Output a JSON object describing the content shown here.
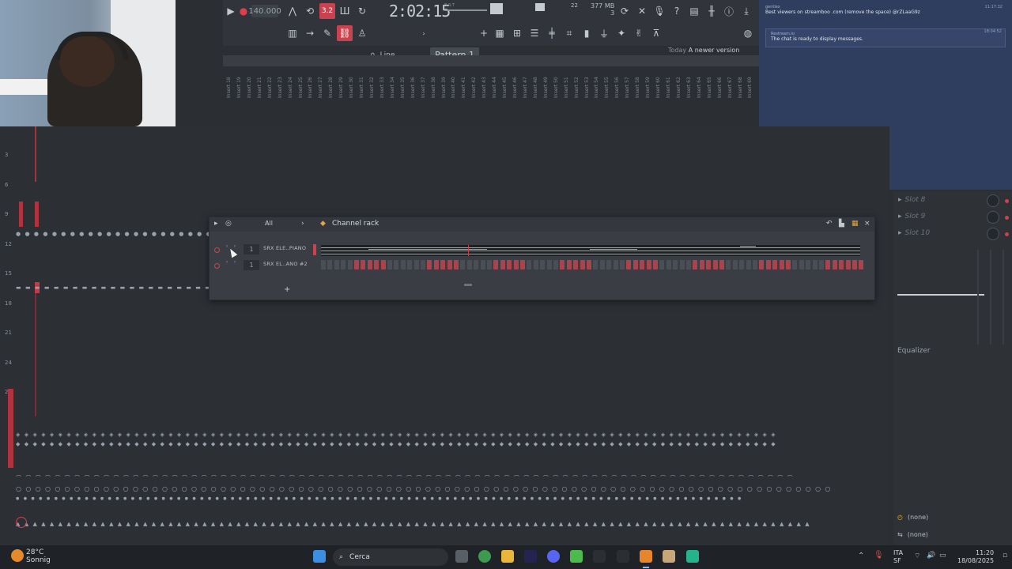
{
  "toolbar": {
    "tempo": "140.000",
    "time": "2:02:15",
    "time_sub": "B:S:T",
    "mem_top": "22",
    "mem": "377 MB",
    "mem_sub": "3",
    "line_label": "Line",
    "pattern_label": "Pattern 1",
    "news_today": "Today",
    "news_text": "A newer version of FL Studio is available!"
  },
  "chat": {
    "messages": [
      {
        "user": "gentlex",
        "text": "Best viewers on streamboo .com (remove the space) @rZLaaG9z",
        "time": "11:17:32"
      },
      {
        "user": "Restream.io",
        "text": "The chat is ready to display messages.",
        "time": "18:04:52"
      }
    ]
  },
  "mixer": {
    "insert_labels": [
      "Insert 18",
      "Insert 19",
      "Insert 20",
      "Insert 21",
      "Insert 22",
      "Insert 23",
      "Insert 24",
      "Insert 25",
      "Insert 26",
      "Insert 27",
      "Insert 28",
      "Insert 29",
      "Insert 30",
      "Insert 31",
      "Insert 32",
      "Insert 33",
      "Insert 34",
      "Insert 35",
      "Insert 36",
      "Insert 37",
      "Insert 38",
      "Insert 39",
      "Insert 40",
      "Insert 41",
      "Insert 42",
      "Insert 43",
      "Insert 44",
      "Insert 45",
      "Insert 46",
      "Insert 47",
      "Insert 48",
      "Insert 49",
      "Insert 50",
      "Insert 51",
      "Insert 52",
      "Insert 53",
      "Insert 54",
      "Insert 55",
      "Insert 56",
      "Insert 57",
      "Insert 58",
      "Insert 59",
      "Insert 60",
      "Insert 61",
      "Insert 62",
      "Insert 63",
      "Insert 64",
      "Insert 65",
      "Insert 66",
      "Insert 67",
      "Insert 68",
      "Insert 69"
    ],
    "ruler": [
      "3",
      "6",
      "9",
      "12",
      "15",
      "18",
      "21",
      "24",
      "27"
    ]
  },
  "rack": {
    "filter": "All",
    "title": "Channel rack",
    "channels": [
      {
        "num": "1",
        "name": "SRX ELE..PIANO"
      },
      {
        "num": "1",
        "name": "SRX EL..ANO #2"
      }
    ],
    "steps": [
      0,
      0,
      0,
      0,
      0,
      1,
      1,
      1,
      1,
      1,
      0,
      0,
      0,
      0,
      0,
      0,
      1,
      1,
      1,
      1,
      1,
      0,
      0,
      0,
      0,
      0,
      1,
      1,
      1,
      1,
      1,
      0,
      0,
      0,
      0,
      0,
      1,
      1,
      1,
      1,
      1,
      0,
      0,
      0,
      0,
      0,
      1,
      1,
      1,
      1,
      1,
      0,
      0,
      0,
      0,
      0,
      1,
      1,
      1,
      1,
      1,
      0,
      0,
      0,
      0,
      0,
      1,
      1,
      1,
      1,
      1,
      0,
      0,
      0,
      0,
      0,
      1,
      1,
      1,
      1,
      1,
      1
    ]
  },
  "rightpanel": {
    "slots": [
      "Slot 8",
      "Slot 9",
      "Slot 10"
    ],
    "eq_label": "Equalizer",
    "none1": "(none)",
    "none2": "(none)"
  },
  "taskbar": {
    "temp": "28°C",
    "weather": "Sonnig",
    "search": "Cerca",
    "lang": "ITA",
    "lang_sub": "SF",
    "time": "11:20",
    "date": "18/08/2025"
  },
  "colors": {
    "accent": "#c8434f",
    "chat_bg": "#2f3e5e",
    "step_on": "#a9444f",
    "step_off": "#4a4f56"
  }
}
